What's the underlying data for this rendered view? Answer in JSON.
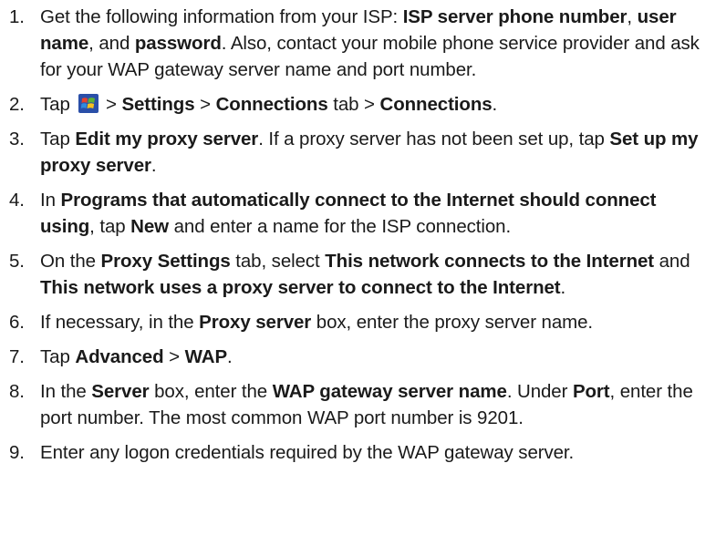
{
  "steps": [
    {
      "number": "1.",
      "parts": [
        {
          "t": "Get the following information from your ISP: "
        },
        {
          "t": "ISP server phone number",
          "b": true
        },
        {
          "t": ", "
        },
        {
          "t": "user name",
          "b": true
        },
        {
          "t": ", and "
        },
        {
          "t": "password",
          "b": true
        },
        {
          "t": ". Also, contact your mobile phone service provider and ask for your WAP gateway server name and port number."
        }
      ]
    },
    {
      "number": "2.",
      "parts": [
        {
          "t": "Tap "
        },
        {
          "icon": "windows-start-icon"
        },
        {
          "t": " > "
        },
        {
          "t": "Settings",
          "b": true
        },
        {
          "t": " > "
        },
        {
          "t": "Connections",
          "b": true
        },
        {
          "t": " tab > "
        },
        {
          "t": "Connections",
          "b": true
        },
        {
          "t": "."
        }
      ]
    },
    {
      "number": "3.",
      "parts": [
        {
          "t": "Tap "
        },
        {
          "t": "Edit my proxy server",
          "b": true
        },
        {
          "t": ". If a proxy server has not been set up, tap "
        },
        {
          "t": "Set up my proxy server",
          "b": true
        },
        {
          "t": "."
        }
      ]
    },
    {
      "number": "4.",
      "parts": [
        {
          "t": "In "
        },
        {
          "t": "Programs that automatically connect to the Internet should connect using",
          "b": true
        },
        {
          "t": ", tap "
        },
        {
          "t": "New",
          "b": true
        },
        {
          "t": " and enter a name for the ISP connection."
        }
      ]
    },
    {
      "number": "5.",
      "parts": [
        {
          "t": "On the "
        },
        {
          "t": "Proxy Settings",
          "b": true
        },
        {
          "t": " tab, select "
        },
        {
          "t": "This network connects to the Internet",
          "b": true
        },
        {
          "t": " and "
        },
        {
          "t": "This network uses a proxy server to connect to the Internet",
          "b": true
        },
        {
          "t": "."
        }
      ]
    },
    {
      "number": "6.",
      "parts": [
        {
          "t": "If necessary, in the "
        },
        {
          "t": "Proxy server",
          "b": true
        },
        {
          "t": " box, enter the proxy server name."
        }
      ]
    },
    {
      "number": "7.",
      "parts": [
        {
          "t": "Tap "
        },
        {
          "t": "Advanced",
          "b": true
        },
        {
          "t": " > "
        },
        {
          "t": "WAP",
          "b": true
        },
        {
          "t": "."
        }
      ]
    },
    {
      "number": "8.",
      "parts": [
        {
          "t": "In the "
        },
        {
          "t": "Server",
          "b": true
        },
        {
          "t": " box, enter the "
        },
        {
          "t": "WAP gateway server name",
          "b": true
        },
        {
          "t": ". Under "
        },
        {
          "t": "Port",
          "b": true
        },
        {
          "t": ", enter the port number. The most common WAP port number is 9201."
        }
      ]
    },
    {
      "number": "9.",
      "parts": [
        {
          "t": "Enter any logon credentials required by the WAP gateway server."
        }
      ]
    }
  ]
}
